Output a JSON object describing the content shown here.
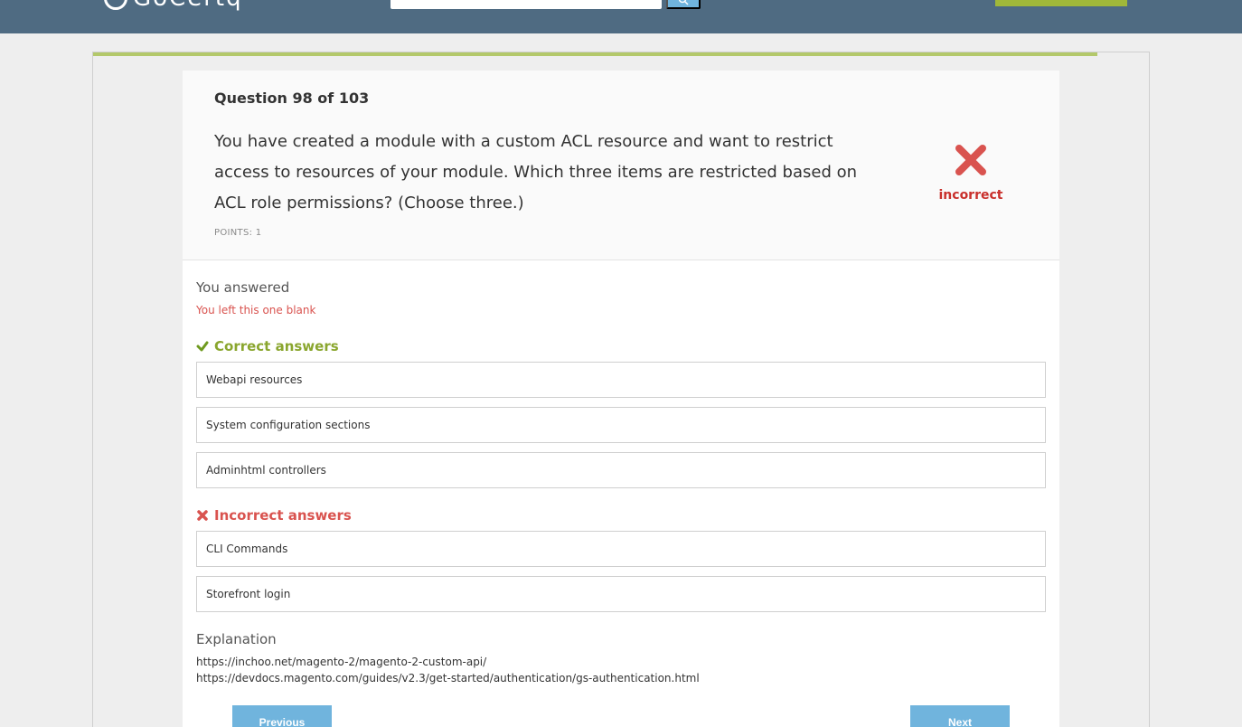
{
  "header": {
    "logo_text": "GoCertq",
    "search_placeholder": "",
    "cta_label": ""
  },
  "question": {
    "number_label": "Question 98 of 103",
    "text": "You have created a module with a custom ACL resource and want to restrict access to resources of your module. Which three items are restricted based on ACL role permissions? (Choose three.)",
    "points": "POINTS: 1",
    "result": "incorrect",
    "result_icon": "red-x-icon"
  },
  "answer": {
    "title": "You answered",
    "note": "You left this one blank"
  },
  "correct": {
    "title": "Correct answers",
    "icon": "green-check-icon",
    "items": [
      "Webapi resources",
      "System configuration sections",
      "Adminhtml controllers"
    ]
  },
  "incorrect": {
    "title": "Incorrect answers",
    "icon": "red-x-icon",
    "items": [
      "CLI Commands",
      "Storefront login"
    ]
  },
  "explanation": {
    "title": "Explanation",
    "links": [
      "https://inchoo.net/magento-2/magento-2-custom-api/",
      "https://devdocs.magento.com/guides/v2.3/get-started/authentication/gs-authentication.html"
    ]
  },
  "nav": {
    "previous": "Previous",
    "next": "Next"
  },
  "colors": {
    "topbar": "#4f6b82",
    "accent_blue": "#70b4dd",
    "correct_green": "#8aa62e",
    "incorrect_red": "#d9534f"
  }
}
